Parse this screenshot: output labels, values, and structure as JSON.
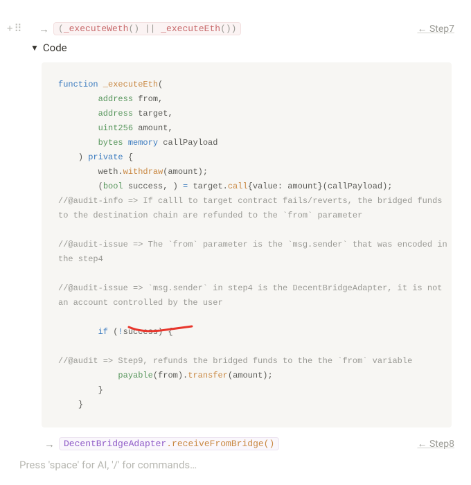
{
  "top": {
    "pill_left": "(",
    "pill_fn1": "_executeWeth",
    "pill_after1": "() || ",
    "pill_fn2": "_executeEth",
    "pill_after2": "())",
    "step_label": "← Step7"
  },
  "toggle": {
    "label": "Code"
  },
  "code": {
    "t1": "function",
    "t2": " _executeEth",
    "t3": "(",
    "t4": "address",
    "t5": " from,",
    "t6": "address",
    "t7": " target,",
    "t8": "uint256",
    "t9": " amount,",
    "t10": "bytes",
    "t11": " memory",
    "t12": " callPayload",
    "t13": ") ",
    "t14": "private",
    "t15": " {",
    "t16": "weth.",
    "t17": "withdraw",
    "t18": "(amount);",
    "t19": "(",
    "t20": "bool",
    "t21": " success, ) ",
    "t22": "=",
    "t23": " target.",
    "t24": "call",
    "t25": "{value: amount}(callPayload);",
    "c1a": "//@audit-info => If calll to target contract fails/reverts, the bridged funds",
    "c1b": "to the destination chain are refunded to the `from` parameter",
    "c2a": "//@audit-issue => The `from` parameter is the `msg.sender` that was encoded in",
    "c2b": "the step4",
    "c3a": "//@audit-issue => `msg.sender` in step4 is the DecentBridgeAdapter, it is not",
    "c3b": "an account controlled by the user",
    "t26": "if",
    "t27": " (",
    "t28": "!",
    "t29": "success) {",
    "c4": "//@audit => Step9, refunds the bridged funds to the the `from` variable",
    "t30": "payable",
    "t31": "(from).",
    "t32": "transfer",
    "t33": "(amount);",
    "t34": "}",
    "t35": "}"
  },
  "bottom": {
    "pill_class": "DecentBridgeAdapter",
    "pill_dot": ".",
    "pill_method": "receiveFromBridge",
    "pill_after": "()",
    "step_label": "← Step8"
  },
  "placeholder": "Press 'space' for AI, '/' for commands…"
}
